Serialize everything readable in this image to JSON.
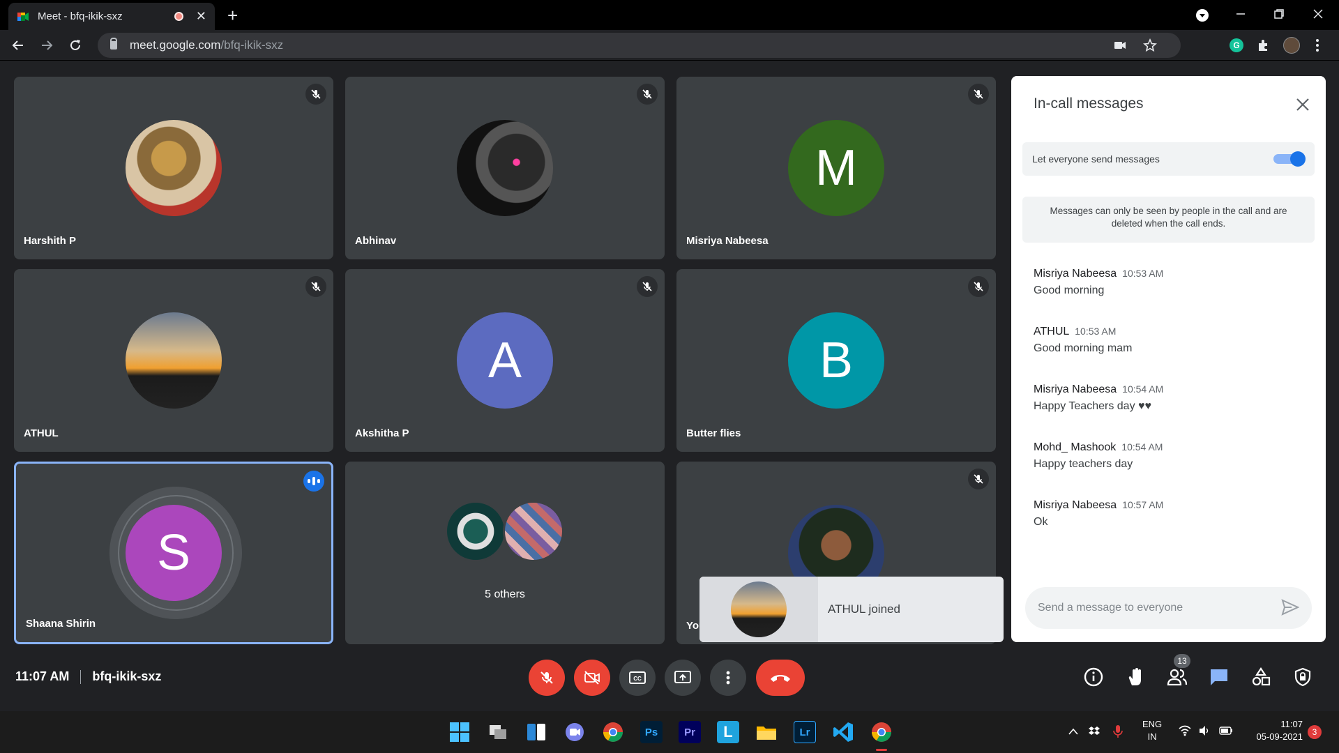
{
  "browser": {
    "tab_title": "Meet - bfq-ikik-sxz",
    "url_host": "meet.google.com",
    "url_path": "/bfq-ikik-sxz",
    "new_tab": "+",
    "tab_close": "✕"
  },
  "tiles": [
    {
      "name": "Harshith P",
      "avatar_type": "photo",
      "muted": true
    },
    {
      "name": "Abhinav",
      "avatar_type": "photo",
      "muted": true
    },
    {
      "name": "Misriya Nabeesa",
      "avatar_letter": "M",
      "avatar_color": "#33691e",
      "muted": true
    },
    {
      "name": "ATHUL",
      "avatar_type": "photo",
      "muted": true
    },
    {
      "name": "Akshitha P",
      "avatar_letter": "A",
      "avatar_color": "#5c6bc0",
      "muted": true
    },
    {
      "name": "Butter flies",
      "avatar_letter": "B",
      "avatar_color": "#0097a7",
      "muted": true
    },
    {
      "name": "Shaana Shirin",
      "avatar_letter": "S",
      "avatar_color": "#ab47bc",
      "speaking": true
    },
    {
      "name": "5 others",
      "avatar_type": "group"
    },
    {
      "name": "You",
      "avatar_type": "photo",
      "muted": true
    }
  ],
  "toast": {
    "text": "ATHUL joined"
  },
  "chat": {
    "title": "In-call messages",
    "toggle_label": "Let everyone send messages",
    "toggle_on": true,
    "info": "Messages can only be seen by people in the call and are deleted when the call ends.",
    "messages": [
      {
        "sender": "Misriya Nabeesa",
        "time": "10:53 AM",
        "text": "Good morning"
      },
      {
        "sender": "ATHUL",
        "time": "10:53 AM",
        "text": "Good morning mam"
      },
      {
        "sender": "Misriya Nabeesa",
        "time": "10:54 AM",
        "text": "Happy Teachers day ♥♥"
      },
      {
        "sender": "Mohd_ Mashook",
        "time": "10:54 AM",
        "text": "Happy teachers day"
      },
      {
        "sender": "Misriya Nabeesa",
        "time": "10:57 AM",
        "text": "Ok"
      }
    ],
    "compose_placeholder": "Send a message to everyone"
  },
  "bottom": {
    "time": "11:07 AM",
    "meeting_code": "bfq-ikik-sxz",
    "people_count": "13"
  },
  "taskbar": {
    "lang": "ENG",
    "region": "IN",
    "clock_time": "11:07",
    "clock_date": "05-09-2021",
    "notifications": "3",
    "apps": [
      "start",
      "task-view",
      "widgets",
      "teams-chat",
      "chrome",
      "Ps",
      "Pr",
      "L",
      "file-explorer",
      "Lr",
      "vscode",
      "chrome-active"
    ]
  },
  "colors": {
    "accent": "#1a73e8",
    "danger": "#ea4335",
    "tile_bg": "#3c4043",
    "stage_bg": "#202124"
  }
}
